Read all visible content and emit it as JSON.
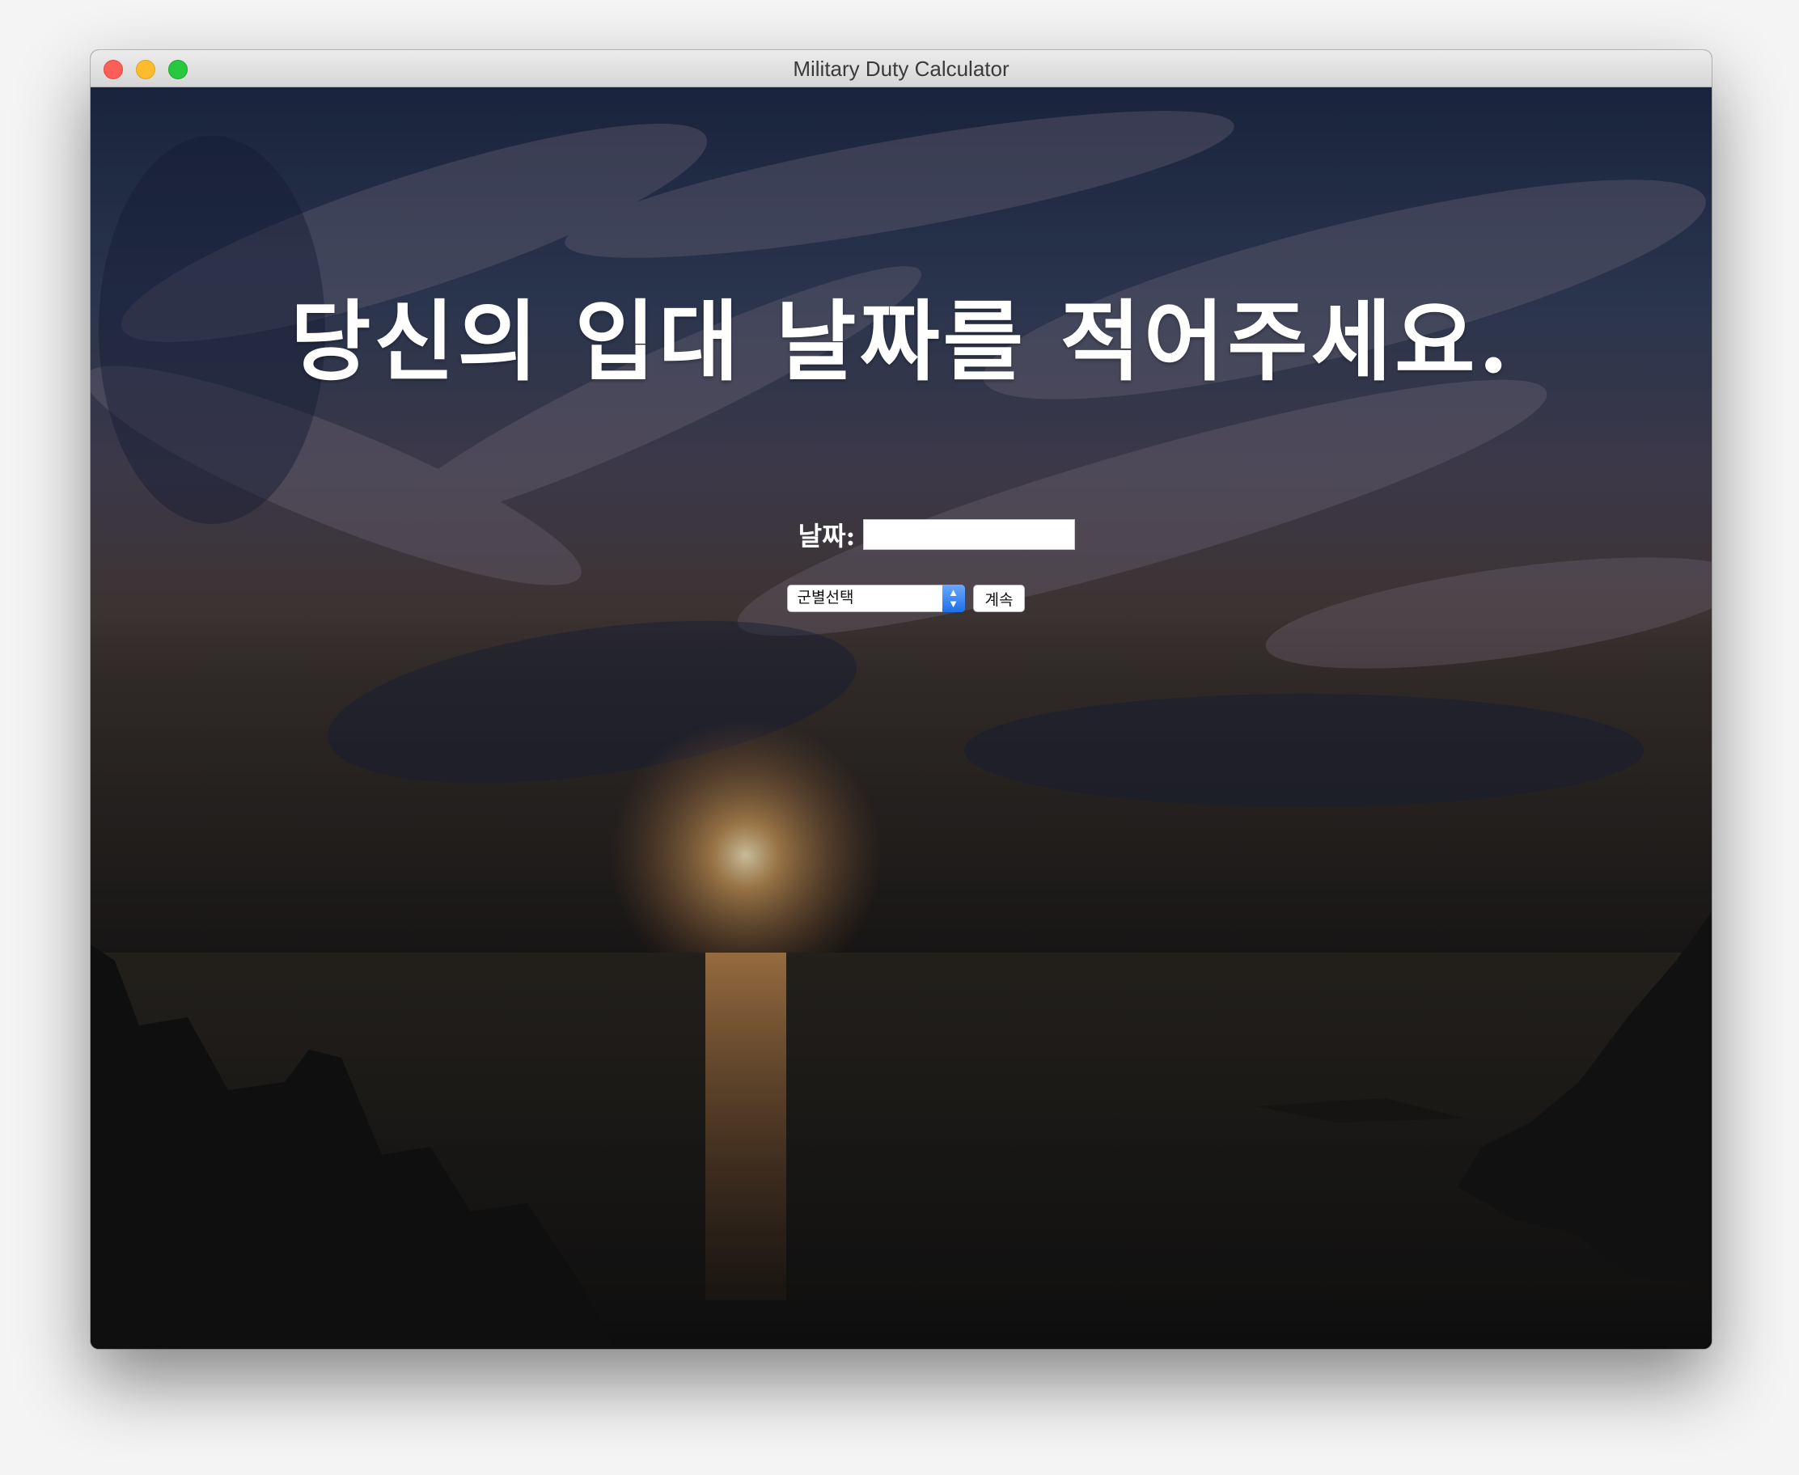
{
  "window": {
    "title": "Military Duty Calculator"
  },
  "main": {
    "heading": "당신의 입대 날짜를 적어주세요.",
    "date_label": "날짜:",
    "date_value": "",
    "branch_select": {
      "selected": "군별선택"
    },
    "continue_label": "계속"
  },
  "icons": {
    "select_arrows": "chevron-up-down-icon"
  },
  "colors": {
    "close": "#fc5f57",
    "minimize": "#fdbc2e",
    "zoom": "#28c840",
    "select_accent": "#1f6fe8"
  }
}
